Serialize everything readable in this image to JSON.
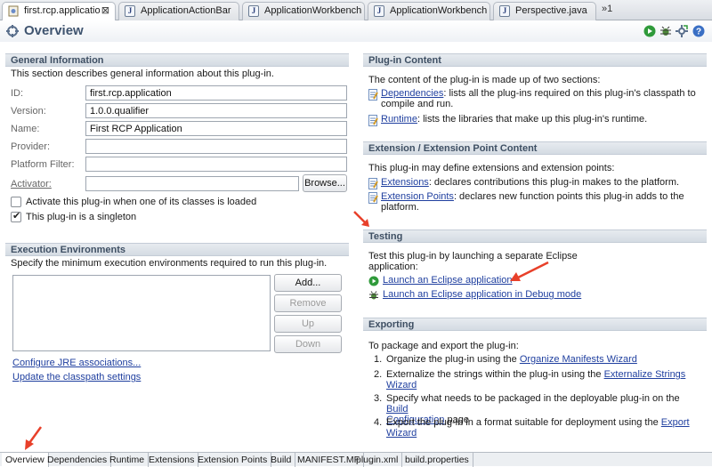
{
  "editor_tabs": [
    {
      "label": "first.rcp.applicatio",
      "active": true
    },
    {
      "label": "ApplicationActionBar",
      "active": false
    },
    {
      "label": "ApplicationWorkbench",
      "active": false
    },
    {
      "label": "ApplicationWorkbench",
      "active": false
    },
    {
      "label": "Perspective.java",
      "active": false
    }
  ],
  "overflow_label": "»1",
  "header": {
    "title": "Overview"
  },
  "general": {
    "title": "General Information",
    "description": "This section describes general information about this plug-in.",
    "fields": {
      "id_label": "ID:",
      "id_value": "first.rcp.application",
      "version_label": "Version:",
      "version_value": "1.0.0.qualifier",
      "name_label": "Name:",
      "name_value": "First RCP Application",
      "provider_label": "Provider:",
      "provider_value": "",
      "platform_filter_label": "Platform Filter:",
      "platform_filter_value": "",
      "activator_label": "Activator:",
      "activator_value": ""
    },
    "browse_label": "Browse...",
    "activate_checkbox_label": "Activate this plug-in when one of its classes is loaded",
    "activate_checked": false,
    "singleton_checkbox_label": "This plug-in is a singleton",
    "singleton_checked": true
  },
  "execution": {
    "title": "Execution Environments",
    "description": "Specify the minimum execution environments required to run this plug-in.",
    "buttons": {
      "add": "Add...",
      "remove": "Remove",
      "up": "Up",
      "down": "Down"
    },
    "link_configure": "Configure JRE associations...",
    "link_update": "Update the classpath settings"
  },
  "plugin_content": {
    "title": "Plug-in Content",
    "intro": "The content of the plug-in is made up of two sections:",
    "dependencies_link": "Dependencies",
    "dependencies_text": ": lists all the plug-ins required on this plug-in's classpath to",
    "dependencies_text2": "compile and run.",
    "runtime_link": "Runtime",
    "runtime_text": ": lists the libraries that make up this plug-in's runtime."
  },
  "extension_content": {
    "title": "Extension / Extension Point Content",
    "intro": "This plug-in may define extensions and extension points:",
    "extensions_link": "Extensions",
    "extensions_text": ": declares contributions this plug-in makes to the platform.",
    "points_link": "Extension Points",
    "points_text": ": declares new function points this plug-in adds to the",
    "points_text2": "platform."
  },
  "testing": {
    "title": "Testing",
    "intro": "Test this plug-in by launching a separate Eclipse",
    "intro2": "application:",
    "launch_link": "Launch an Eclipse application",
    "debug_link": "Launch an Eclipse application in Debug mode"
  },
  "exporting": {
    "title": "Exporting",
    "intro": "To package and export the plug-in:",
    "steps": [
      {
        "num": "1.",
        "text": "Organize the plug-in using the",
        "link": "Organize Manifests Wizard",
        "text2": "",
        "link2": ""
      },
      {
        "num": "2.",
        "text": "Externalize the strings within the plug-in using the",
        "link": "Externalize Strings",
        "text2": "",
        "link2": "Wizard"
      },
      {
        "num": "3.",
        "text": "Specify what needs to be packaged in the deployable plug-in on the",
        "link": "Build",
        "text2": "page",
        "link2": "Configuration"
      },
      {
        "num": "4.",
        "text": "Export the plug-in in a format suitable for deployment using the",
        "link": "Export",
        "text2": "",
        "link2": "Wizard"
      }
    ]
  },
  "bottom_tabs": [
    "Overview",
    "Dependencies",
    "Runtime",
    "Extensions",
    "Extension Points",
    "Build",
    "MANIFEST.MF",
    "plugin.xml",
    "build.properties"
  ],
  "colors": {
    "link": "#1f3f9f",
    "section_title": "#3e4f63",
    "annotation_arrow": "#e8402a",
    "run_green": "#2f9a3a"
  },
  "icons": {
    "header_run": "run-icon",
    "header_debug": "debug-icon",
    "header_export": "export-icon",
    "header_help": "help-icon"
  }
}
